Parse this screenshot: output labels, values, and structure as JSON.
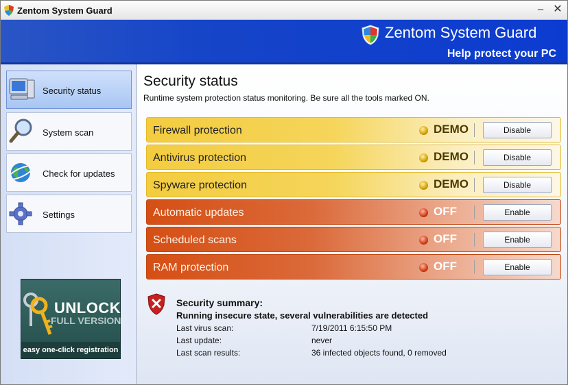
{
  "window": {
    "title": "Zentom System Guard",
    "minimize_glyph": "–",
    "close_glyph": "✕"
  },
  "header": {
    "brand_name": "Zentom System Guard",
    "tagline": "Help protect your PC"
  },
  "sidebar": {
    "items": [
      {
        "label": "Security status",
        "icon": "computer-icon",
        "active": true
      },
      {
        "label": "System scan",
        "icon": "magnifier-icon",
        "active": false
      },
      {
        "label": "Check for updates",
        "icon": "globe-icon",
        "active": false
      },
      {
        "label": "Settings",
        "icon": "gear-icon",
        "active": false
      }
    ],
    "unlock": {
      "title": "UNLOCK",
      "subtitle": "FULL VERSION",
      "footer": "easy one-click registration"
    }
  },
  "main": {
    "title": "Security status",
    "description": "Runtime system protection status monitoring. Be sure all the tools marked ON.",
    "protections": [
      {
        "label": "Firewall protection",
        "status": "DEMO",
        "action": "Disable"
      },
      {
        "label": "Antivirus protection",
        "status": "DEMO",
        "action": "Disable"
      },
      {
        "label": "Spyware protection",
        "status": "DEMO",
        "action": "Disable"
      },
      {
        "label": "Automatic updates",
        "status": "OFF",
        "action": "Enable"
      },
      {
        "label": "Scheduled scans",
        "status": "OFF",
        "action": "Enable"
      },
      {
        "label": "RAM protection",
        "status": "OFF",
        "action": "Enable"
      }
    ],
    "summary": {
      "title": "Security summary:",
      "warning": "Running insecure state, several vulnerabilities are detected",
      "details": [
        {
          "label": "Last virus scan:",
          "value": "7/19/2011 6:15:50 PM"
        },
        {
          "label": "Last update:",
          "value": "never"
        },
        {
          "label": "Last scan results:",
          "value": "36 infected objects found, 0 removed"
        }
      ]
    }
  },
  "colors": {
    "header_blue": "#1645c8",
    "demo_yellow": "#f3cc40",
    "off_orange": "#d54f14",
    "sidebar_bg": "#d4dff5",
    "unlock_green": "#3b6b68"
  }
}
